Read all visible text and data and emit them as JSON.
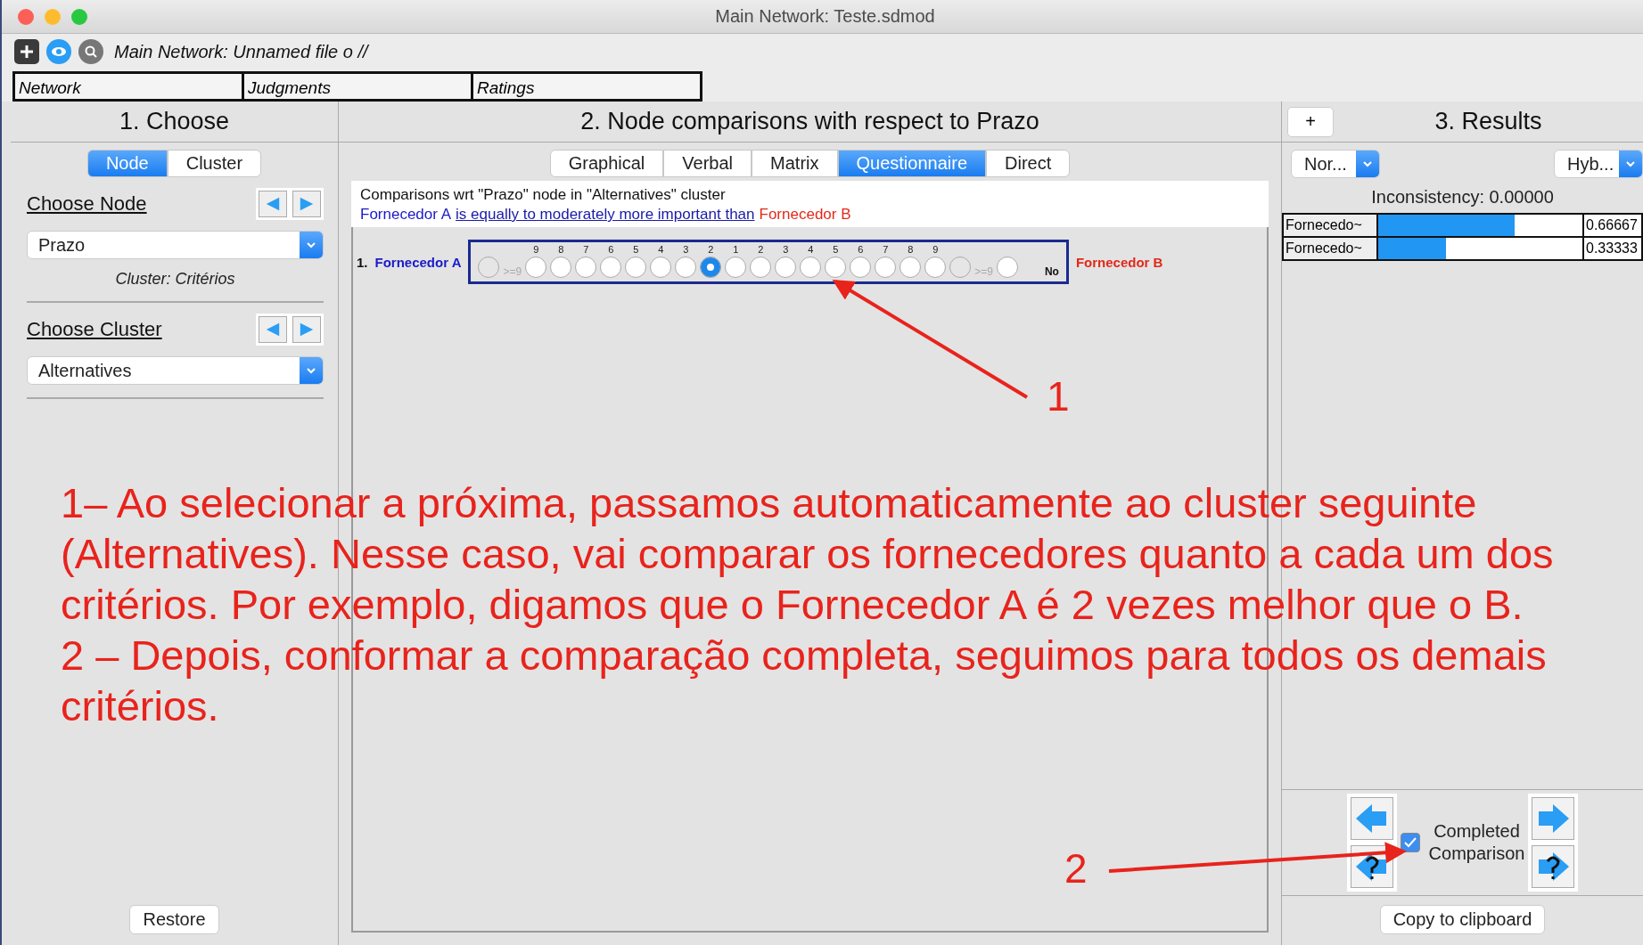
{
  "window": {
    "title": "Main Network: Teste.sdmod"
  },
  "toolbar": {
    "title": "Main Network: Unnamed file o //"
  },
  "main_tabs": [
    {
      "label": "Network"
    },
    {
      "label": "Judgments"
    },
    {
      "label": "Ratings"
    }
  ],
  "choose_panel": {
    "title": "1. Choose",
    "mode_tabs": [
      {
        "label": "Node",
        "selected": true
      },
      {
        "label": "Cluster",
        "selected": false
      }
    ],
    "node_heading": "Choose Node",
    "node_value": "Prazo",
    "cluster_note": "Cluster: Critérios",
    "cluster_heading": "Choose Cluster",
    "cluster_value": "Alternatives",
    "restore": "Restore"
  },
  "comparison_panel": {
    "title": "2. Node comparisons with respect to Prazo",
    "tabs": [
      {
        "label": "Graphical",
        "selected": false
      },
      {
        "label": "Verbal",
        "selected": false
      },
      {
        "label": "Matrix",
        "selected": false
      },
      {
        "label": "Questionnaire",
        "selected": true
      },
      {
        "label": "Direct",
        "selected": false
      }
    ],
    "summary": "Comparisons wrt \"Prazo\" node in \"Alternatives\" cluster",
    "verdict": {
      "left": "Fornecedor A",
      "middle": "is equally to moderately more important than",
      "right": "Fornecedor B"
    },
    "row": {
      "index": "1.",
      "left": "Fornecedor A",
      "right": "Fornecedor B",
      "scale": [
        {
          "kind": "extreme",
          "label": ">=9",
          "selected": false
        },
        {
          "kind": "number",
          "label": "9",
          "selected": false
        },
        {
          "kind": "number",
          "label": "8",
          "selected": false
        },
        {
          "kind": "number",
          "label": "7",
          "selected": false
        },
        {
          "kind": "number",
          "label": "6",
          "selected": false
        },
        {
          "kind": "number",
          "label": "5",
          "selected": false
        },
        {
          "kind": "number",
          "label": "4",
          "selected": false
        },
        {
          "kind": "number",
          "label": "3",
          "selected": false
        },
        {
          "kind": "number",
          "label": "2",
          "selected": true
        },
        {
          "kind": "number",
          "label": "1",
          "selected": false
        },
        {
          "kind": "number",
          "label": "2",
          "selected": false
        },
        {
          "kind": "number",
          "label": "3",
          "selected": false
        },
        {
          "kind": "number",
          "label": "4",
          "selected": false
        },
        {
          "kind": "number",
          "label": "5",
          "selected": false
        },
        {
          "kind": "number",
          "label": "6",
          "selected": false
        },
        {
          "kind": "number",
          "label": "7",
          "selected": false
        },
        {
          "kind": "number",
          "label": "8",
          "selected": false
        },
        {
          "kind": "number",
          "label": "9",
          "selected": false
        },
        {
          "kind": "extreme",
          "label": ">=9",
          "selected": false
        },
        {
          "kind": "none",
          "label": "No",
          "selected": false
        }
      ]
    }
  },
  "results_panel": {
    "add": "+",
    "title": "3. Results",
    "left_select": "Nor...",
    "right_select": "Hyb...",
    "inconsistency": "Inconsistency: 0.00000",
    "rows": [
      {
        "name": "Fornecedo~",
        "level": 0.66667,
        "value": "0.66667"
      },
      {
        "name": "Fornecedo~",
        "level": 0.33333,
        "value": "0.33333"
      }
    ],
    "completed": {
      "label_1": "Completed",
      "label_2": "Comparison",
      "checked": true
    },
    "copy": "Copy to clipboard"
  },
  "annotations": {
    "paragraphs": [
      "1– Ao selecionar a próxima, passamos automaticamente ao cluster seguinte (Alternatives). Nesse caso, vai comparar os fornecedores quanto a cada um dos critérios. Por exemplo, digamos que o Fornecedor A é 2 vezes melhor que o B.",
      "2 – Depois, conformar a comparação completa, seguimos para todos os demais critérios."
    ],
    "marker_1": "1",
    "marker_2": "2"
  }
}
